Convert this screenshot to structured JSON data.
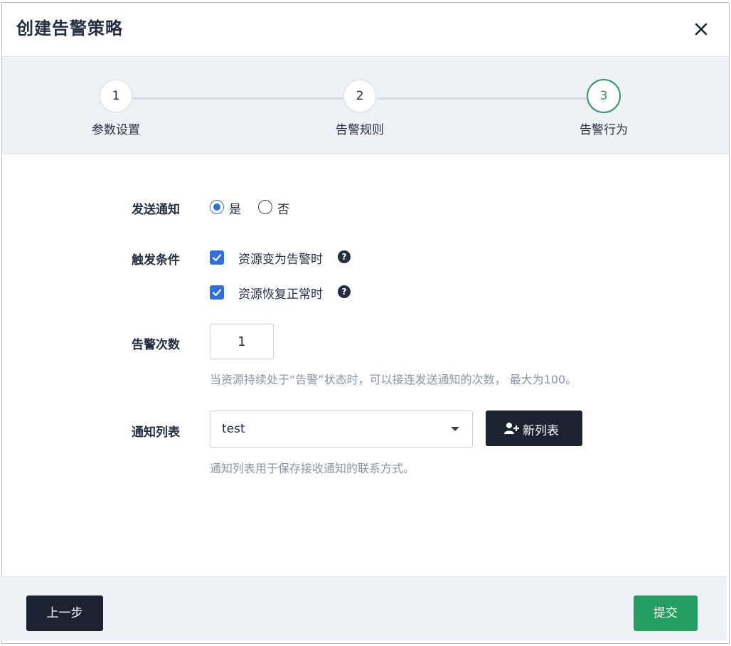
{
  "modal": {
    "title": "创建告警策略",
    "close_icon": "close-icon"
  },
  "steps": [
    {
      "number": "1",
      "label": "参数设置",
      "active": false
    },
    {
      "number": "2",
      "label": "告警规则",
      "active": false
    },
    {
      "number": "3",
      "label": "告警行为",
      "active": true
    }
  ],
  "form": {
    "send_notification": {
      "label": "发送通知",
      "options": [
        {
          "label": "是",
          "selected": true
        },
        {
          "label": "否",
          "selected": false
        }
      ]
    },
    "trigger_conditions": {
      "label": "触发条件",
      "options": [
        {
          "label": "资源变为告警时",
          "checked": true
        },
        {
          "label": "资源恢复正常时",
          "checked": true
        }
      ]
    },
    "alert_count": {
      "label": "告警次数",
      "value": "1",
      "hint": "当资源持续处于“告警”状态时，可以接连发送通知的次数， 最大为100。"
    },
    "notification_list": {
      "label": "通知列表",
      "selected": "test",
      "new_button_label": "新列表",
      "hint": "通知列表用于保存接收通知的联系方式。"
    }
  },
  "footer": {
    "prev_label": "上一步",
    "submit_label": "提交"
  },
  "colors": {
    "primary_blue": "#2f6fe0",
    "success_green": "#23a061",
    "dark": "#1b2330"
  }
}
